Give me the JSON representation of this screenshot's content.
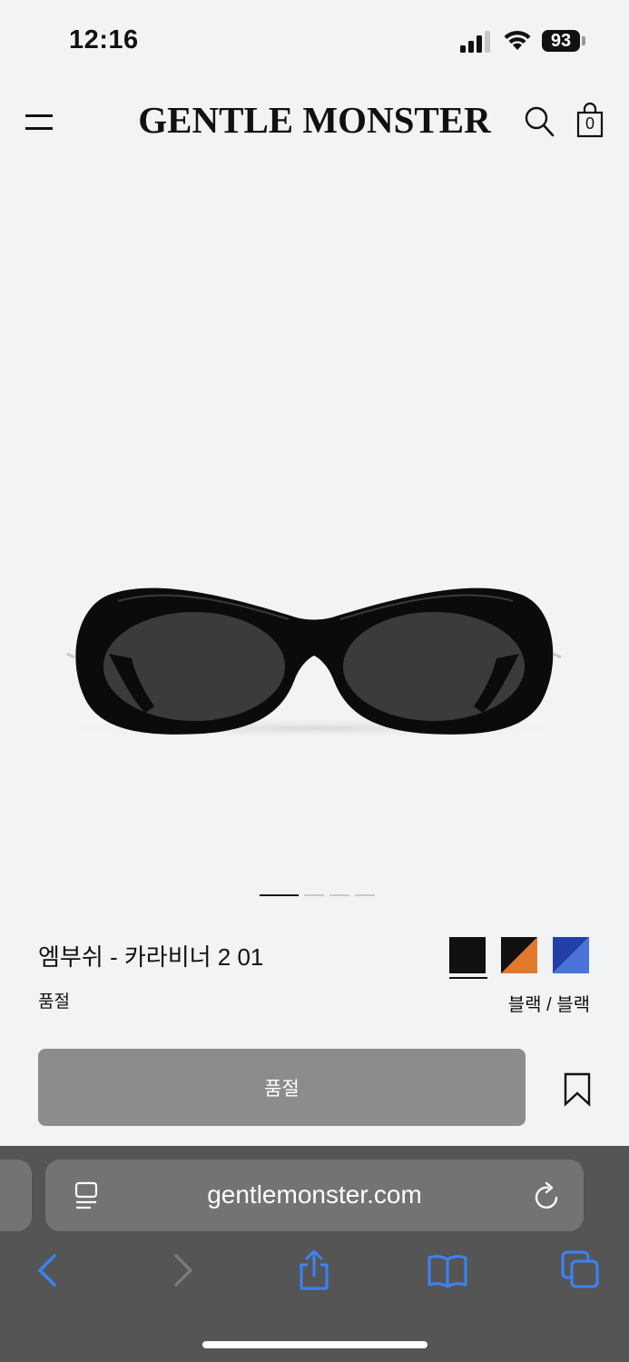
{
  "status_bar": {
    "time": "12:16",
    "battery_percent": "93",
    "signal_bars": 3,
    "wifi_strength": 3
  },
  "header": {
    "brand": "GENTLE MONSTER",
    "cart_count": "0",
    "icons": [
      "menu-icon",
      "search-icon",
      "shopping-bag-icon"
    ]
  },
  "gallery": {
    "image_count": 4,
    "active_index": 0
  },
  "product": {
    "name": "엠부쉬 - 카라비너 2 01",
    "stock_status": "품절",
    "color_label": "블랙 / 블랙",
    "swatches": [
      {
        "name": "black",
        "colors": [
          "#111111"
        ],
        "selected": true
      },
      {
        "name": "black-orange",
        "colors": [
          "#111111",
          "#e07a2a"
        ],
        "selected": false
      },
      {
        "name": "blue-white",
        "colors": [
          "#2240a8",
          "#ffffff"
        ],
        "selected": false
      }
    ],
    "button_label": "품절"
  },
  "browser": {
    "url": "gentlemonster.com",
    "icons": [
      "reader-icon",
      "reload-icon",
      "back-icon",
      "forward-icon",
      "share-icon",
      "bookmarks-icon",
      "tabs-icon"
    ]
  },
  "colors": {
    "background": "#f2f3f5",
    "button_disabled": "#8c8c8c",
    "browser_chrome": "#555556",
    "browser_accent": "#3b82f6"
  }
}
